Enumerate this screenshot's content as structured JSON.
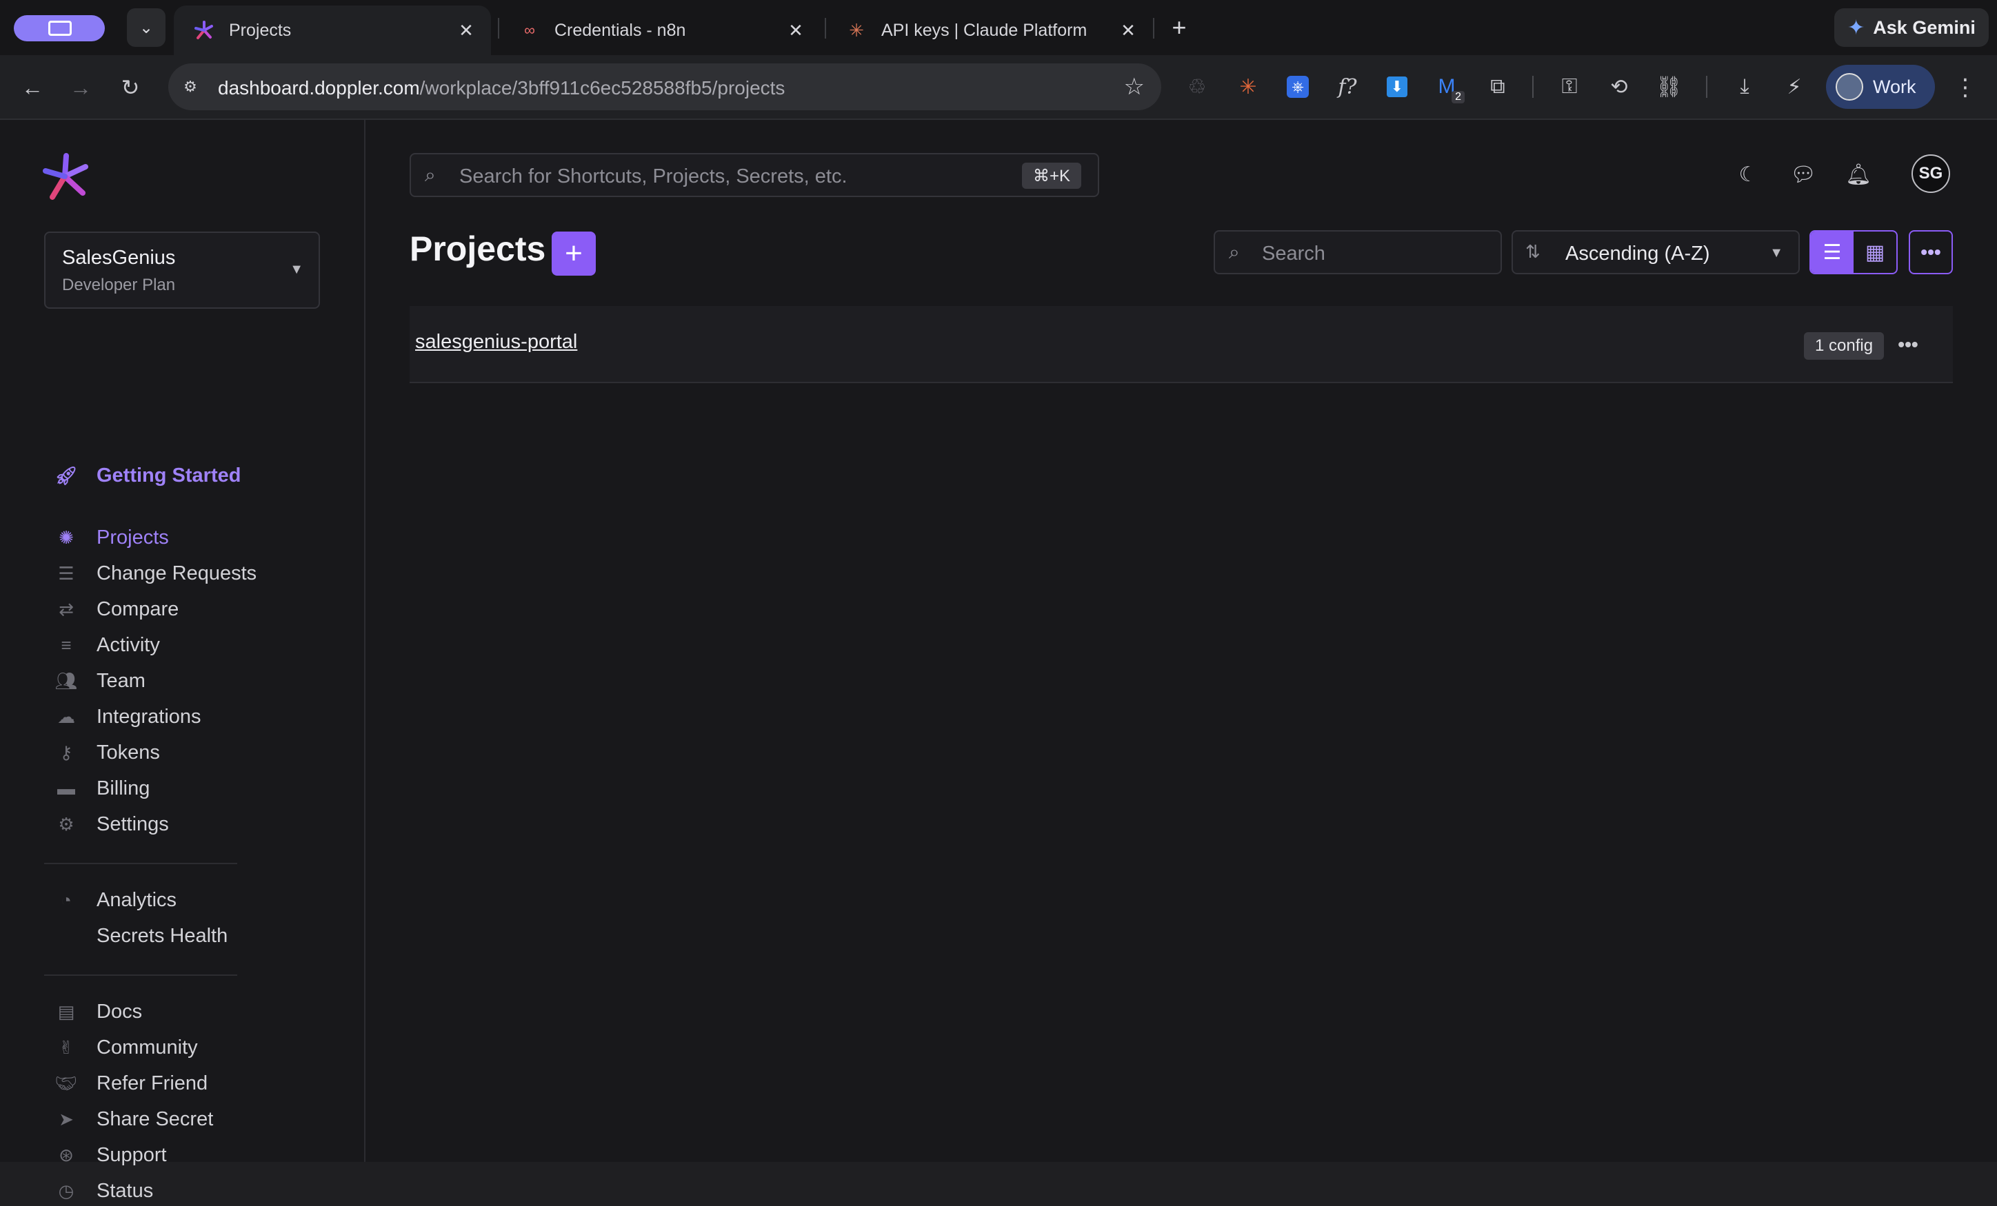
{
  "browser": {
    "tabs": [
      {
        "title": "Projects",
        "active": true
      },
      {
        "title": "Credentials - n8n",
        "active": false
      },
      {
        "title": "API keys | Claude Platform",
        "active": false
      }
    ],
    "gemini_label": "Ask Gemini",
    "url_host": "dashboard.doppler.com",
    "url_path": "/workplace/3bff911c6ec528588fb5/projects",
    "extension_badge": "2",
    "profile_label": "Work"
  },
  "sidebar": {
    "org_name": "SalesGenius",
    "org_plan": "Developer Plan",
    "getting_started": "Getting Started",
    "nav": [
      {
        "label": "Projects",
        "icon": "projects-icon"
      },
      {
        "label": "Change Requests",
        "icon": "checklist-icon"
      },
      {
        "label": "Compare",
        "icon": "compare-icon"
      },
      {
        "label": "Activity",
        "icon": "activity-icon"
      },
      {
        "label": "Team",
        "icon": "team-icon"
      },
      {
        "label": "Integrations",
        "icon": "cloud-icon"
      },
      {
        "label": "Tokens",
        "icon": "key-icon"
      },
      {
        "label": "Billing",
        "icon": "card-icon"
      },
      {
        "label": "Settings",
        "icon": "gear-icon"
      }
    ],
    "analytics": [
      {
        "label": "Analytics",
        "icon": "pie-icon"
      },
      {
        "label": "Secrets Health",
        "icon": ""
      }
    ],
    "resources": [
      {
        "label": "Docs",
        "icon": "book-icon"
      },
      {
        "label": "Community",
        "icon": "hand-icon"
      },
      {
        "label": "Refer Friend",
        "icon": "handshake-icon"
      },
      {
        "label": "Share Secret",
        "icon": "send-icon"
      },
      {
        "label": "Support",
        "icon": "lifebuoy-icon"
      },
      {
        "label": "Status",
        "icon": "clock-icon"
      }
    ]
  },
  "main": {
    "command_search_placeholder": "Search for Shortcuts, Projects, Secrets, etc.",
    "command_shortcut": "⌘+K",
    "avatar_initials": "SG",
    "page_title": "Projects",
    "search_placeholder": "Search",
    "sort_value": "Ascending (A-Z)",
    "projects": [
      {
        "name": "salesgenius-portal",
        "configs": "1 config"
      }
    ]
  },
  "colors": {
    "accent": "#8b5cf6",
    "accent_text": "#9f82f8",
    "background": "#18181b"
  }
}
